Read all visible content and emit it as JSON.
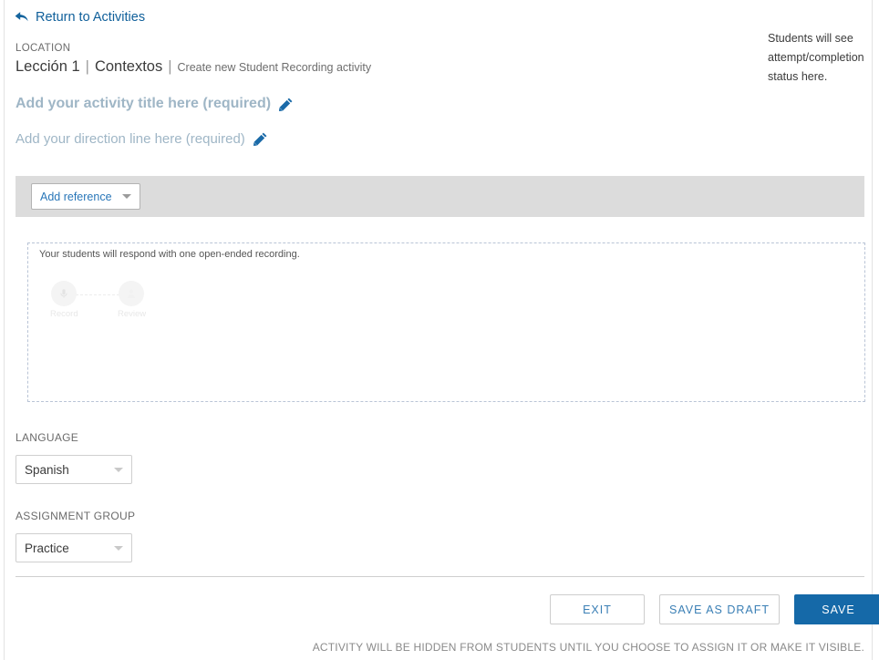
{
  "header": {
    "return_link": "Return to Activities",
    "return_icon": "back-arrow-icon",
    "location_label": "LOCATION",
    "breadcrumb": {
      "lesson": "Lección 1",
      "separator": "|",
      "section": "Contextos",
      "separator2": "|",
      "action": "Create new Student Recording activity"
    },
    "status_note": "Students will see attempt/completion status here."
  },
  "editors": {
    "title_placeholder": "Add your activity title here (required)",
    "direction_placeholder": "Add your direction line here (required)",
    "edit_icon": "pencil-icon"
  },
  "toolbar": {
    "add_reference_label": "Add reference",
    "caret_icon": "chevron-down-icon"
  },
  "response": {
    "hint": "Your students will respond with one open-ended recording.",
    "steps": [
      {
        "label": "Record",
        "icon": "microphone-icon"
      },
      {
        "label": "Review",
        "icon": "person-icon"
      }
    ]
  },
  "fields": {
    "language": {
      "label": "LANGUAGE",
      "value": "Spanish",
      "caret_icon": "chevron-down-icon"
    },
    "assignment_group": {
      "label": "ASSIGNMENT GROUP",
      "value": "Practice",
      "caret_icon": "chevron-down-icon"
    }
  },
  "footer": {
    "exit_label": "EXIT",
    "save_draft_label": "SAVE AS DRAFT",
    "save_label": "SAVE",
    "note": "ACTIVITY WILL BE HIDDEN FROM STUDENTS UNTIL YOU CHOOSE TO ASSIGN IT OR MAKE IT VISIBLE."
  },
  "colors": {
    "link_blue": "#0f5f9a",
    "primary_blue": "#1569a8",
    "outline_text_blue": "#3a7fb5",
    "toolbar_gray": "#dcdcdc",
    "placeholder_blue_gray": "#9fb6c6"
  }
}
